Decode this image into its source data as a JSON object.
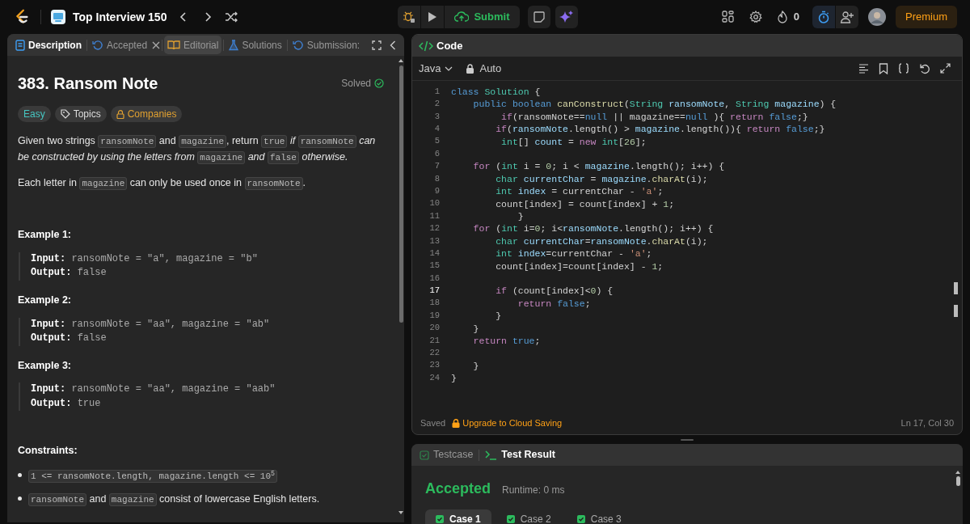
{
  "topbar": {
    "list_title": "Top Interview 150",
    "submit": "Submit",
    "streak": "0",
    "premium": "Premium"
  },
  "description_panel": {
    "tabs": [
      {
        "label": "Description",
        "selected": true,
        "highlighted": false,
        "closable": false
      },
      {
        "label": "Accepted",
        "selected": false,
        "highlighted": false,
        "closable": true
      },
      {
        "label": "Editorial",
        "selected": false,
        "highlighted": true,
        "closable": false
      },
      {
        "label": "Solutions",
        "selected": false,
        "highlighted": false,
        "closable": false
      },
      {
        "label": "Submission:",
        "selected": false,
        "highlighted": false,
        "closable": false
      }
    ],
    "title": "383. Ransom Note",
    "status": "Solved",
    "badges": [
      {
        "label": "Easy",
        "kind": "difficulty"
      },
      {
        "label": "Topics",
        "kind": "topics"
      },
      {
        "label": "Companies",
        "kind": "companies"
      }
    ],
    "paragraphs": [
      [
        {
          "text": "Given two strings ",
          "kind": "text"
        },
        {
          "text": "ransomNote",
          "kind": "code"
        },
        {
          "text": " and ",
          "kind": "text"
        },
        {
          "text": "magazine",
          "kind": "code"
        },
        {
          "text": ", return ",
          "kind": "text"
        },
        {
          "text": "true",
          "kind": "code"
        },
        {
          "text": " if ",
          "kind": "italic"
        },
        {
          "text": "ransomNote",
          "kind": "code"
        },
        {
          "text": " can be constructed by using the letters from ",
          "kind": "italic"
        },
        {
          "text": "magazine",
          "kind": "code"
        },
        {
          "text": " and ",
          "kind": "italic"
        },
        {
          "text": "false",
          "kind": "code"
        },
        {
          "text": " otherwise.",
          "kind": "italic"
        }
      ],
      [
        {
          "text": "Each letter in ",
          "kind": "text"
        },
        {
          "text": "magazine",
          "kind": "code"
        },
        {
          "text": " can only be used once in ",
          "kind": "text"
        },
        {
          "text": "ransomNote",
          "kind": "code"
        },
        {
          "text": ".",
          "kind": "text"
        }
      ]
    ],
    "examples": [
      {
        "heading": "Example 1:",
        "input_label": "Input:",
        "input": "ransomNote = \"a\", magazine = \"b\"",
        "output_label": "Output:",
        "output": "false"
      },
      {
        "heading": "Example 2:",
        "input_label": "Input:",
        "input": "ransomNote = \"aa\", magazine = \"ab\"",
        "output_label": "Output:",
        "output": "false"
      },
      {
        "heading": "Example 3:",
        "input_label": "Input:",
        "input": "ransomNote = \"aa\", magazine = \"aab\"",
        "output_label": "Output:",
        "output": "true"
      }
    ],
    "constraints_heading": "Constraints:",
    "constraints": [
      [
        {
          "text": "1 <= ransomNote.length, magazine.length <= 10$^{5}$",
          "kind": "code"
        }
      ],
      [
        {
          "text": "ransomNote",
          "kind": "code"
        },
        {
          "text": " and ",
          "kind": "text"
        },
        {
          "text": "magazine",
          "kind": "code"
        },
        {
          "text": " consist of lowercase English letters.",
          "kind": "text"
        }
      ]
    ]
  },
  "code_panel": {
    "title": "Code",
    "language": "Java",
    "mode": "Auto",
    "lines": [
      {
        "number": "1",
        "current": false,
        "tokens": [
          {
            "text": "class",
            "kind": "decl"
          },
          {
            "text": " Solution",
            "kind": "type"
          },
          {
            "text": " {",
            "kind": "plain"
          }
        ]
      },
      {
        "number": "2",
        "current": false,
        "tokens": [
          {
            "text": "    public boolean",
            "kind": "decl"
          },
          {
            "text": " canConstruct",
            "kind": "fn"
          },
          {
            "text": "(",
            "kind": "plain"
          },
          {
            "text": "String",
            "kind": "type"
          },
          {
            "text": " ransomNote",
            "kind": "var"
          },
          {
            "text": ", ",
            "kind": "plain"
          },
          {
            "text": "String",
            "kind": "type"
          },
          {
            "text": " magazine",
            "kind": "var"
          },
          {
            "text": ") {",
            "kind": "plain"
          }
        ]
      },
      {
        "number": "3",
        "current": false,
        "tokens": [
          {
            "text": "         if",
            "kind": "kw"
          },
          {
            "text": "(ransomNote==",
            "kind": "plain"
          },
          {
            "text": "null",
            "kind": "decl"
          },
          {
            "text": " || magazine==",
            "kind": "plain"
          },
          {
            "text": "null",
            "kind": "decl"
          },
          {
            "text": " ){ ",
            "kind": "plain"
          },
          {
            "text": "return",
            "kind": "kw"
          },
          {
            "text": " false",
            "kind": "decl"
          },
          {
            "text": ";}",
            "kind": "plain"
          }
        ]
      },
      {
        "number": "4",
        "current": false,
        "tokens": [
          {
            "text": "        if",
            "kind": "kw"
          },
          {
            "text": "(",
            "kind": "plain"
          },
          {
            "text": "ransomNote",
            "kind": "var"
          },
          {
            "text": ".length() > ",
            "kind": "plain"
          },
          {
            "text": "magazine",
            "kind": "var"
          },
          {
            "text": ".length()){ ",
            "kind": "plain"
          },
          {
            "text": "return",
            "kind": "kw"
          },
          {
            "text": " false",
            "kind": "decl"
          },
          {
            "text": ";}",
            "kind": "plain"
          }
        ]
      },
      {
        "number": "5",
        "current": false,
        "tokens": [
          {
            "text": "         int",
            "kind": "type"
          },
          {
            "text": "[] ",
            "kind": "plain"
          },
          {
            "text": "count",
            "kind": "var"
          },
          {
            "text": " = ",
            "kind": "plain"
          },
          {
            "text": "new",
            "kind": "kw"
          },
          {
            "text": " int",
            "kind": "type"
          },
          {
            "text": "[",
            "kind": "plain"
          },
          {
            "text": "26",
            "kind": "num"
          },
          {
            "text": "];",
            "kind": "plain"
          }
        ]
      },
      {
        "number": "6",
        "current": false
      },
      {
        "number": "7",
        "current": false,
        "tokens": [
          {
            "text": "    for",
            "kind": "kw"
          },
          {
            "text": " (",
            "kind": "plain"
          },
          {
            "text": "int",
            "kind": "type"
          },
          {
            "text": " i = ",
            "kind": "plain"
          },
          {
            "text": "0",
            "kind": "num"
          },
          {
            "text": "; i < ",
            "kind": "plain"
          },
          {
            "text": "magazine",
            "kind": "var"
          },
          {
            "text": ".length(); i++) {",
            "kind": "plain"
          }
        ]
      },
      {
        "number": "8",
        "current": false,
        "tokens": [
          {
            "text": "        char",
            "kind": "type"
          },
          {
            "text": " currentChar",
            "kind": "var"
          },
          {
            "text": " = ",
            "kind": "plain"
          },
          {
            "text": "magazine",
            "kind": "var"
          },
          {
            "text": ".",
            "kind": "plain"
          },
          {
            "text": "charAt",
            "kind": "fn"
          },
          {
            "text": "(i);",
            "kind": "plain"
          }
        ]
      },
      {
        "number": "9",
        "current": false,
        "tokens": [
          {
            "text": "        int",
            "kind": "type"
          },
          {
            "text": " index",
            "kind": "var"
          },
          {
            "text": " = currentChar - ",
            "kind": "plain"
          },
          {
            "text": "'a'",
            "kind": "str"
          },
          {
            "text": ";",
            "kind": "plain"
          }
        ]
      },
      {
        "number": "10",
        "current": false,
        "tokens": [
          {
            "text": "        count[index] = count[index] + ",
            "kind": "plain"
          },
          {
            "text": "1",
            "kind": "num"
          },
          {
            "text": ";",
            "kind": "plain"
          }
        ]
      },
      {
        "number": "11",
        "current": false,
        "tokens": [
          {
            "text": "            }",
            "kind": "plain"
          }
        ]
      },
      {
        "number": "12",
        "current": false,
        "tokens": [
          {
            "text": "    for",
            "kind": "kw"
          },
          {
            "text": " (",
            "kind": "plain"
          },
          {
            "text": "int",
            "kind": "type"
          },
          {
            "text": " i=",
            "kind": "plain"
          },
          {
            "text": "0",
            "kind": "num"
          },
          {
            "text": "; i<",
            "kind": "plain"
          },
          {
            "text": "ransomNote",
            "kind": "var"
          },
          {
            "text": ".length(); i++) {",
            "kind": "plain"
          }
        ]
      },
      {
        "number": "13",
        "current": false,
        "tokens": [
          {
            "text": "        char",
            "kind": "type"
          },
          {
            "text": " currentChar",
            "kind": "var"
          },
          {
            "text": "=",
            "kind": "plain"
          },
          {
            "text": "ransomNote",
            "kind": "var"
          },
          {
            "text": ".",
            "kind": "plain"
          },
          {
            "text": "charAt",
            "kind": "fn"
          },
          {
            "text": "(i);",
            "kind": "plain"
          }
        ]
      },
      {
        "number": "14",
        "current": false,
        "tokens": [
          {
            "text": "        int",
            "kind": "type"
          },
          {
            "text": " index",
            "kind": "var"
          },
          {
            "text": "=currentChar - ",
            "kind": "plain"
          },
          {
            "text": "'a'",
            "kind": "str"
          },
          {
            "text": ";",
            "kind": "plain"
          }
        ]
      },
      {
        "number": "15",
        "current": false,
        "tokens": [
          {
            "text": "        count[index]=count[index] - ",
            "kind": "plain"
          },
          {
            "text": "1",
            "kind": "num"
          },
          {
            "text": ";",
            "kind": "plain"
          }
        ]
      },
      {
        "number": "16",
        "current": false
      },
      {
        "number": "17",
        "current": true,
        "tokens": [
          {
            "text": "        if",
            "kind": "kw"
          },
          {
            "text": " (count[index]<",
            "kind": "plain"
          },
          {
            "text": "0",
            "kind": "num"
          },
          {
            "text": ") {",
            "kind": "plain"
          }
        ]
      },
      {
        "number": "18",
        "current": false,
        "tokens": [
          {
            "text": "            return",
            "kind": "kw"
          },
          {
            "text": " false",
            "kind": "decl"
          },
          {
            "text": ";",
            "kind": "plain"
          }
        ]
      },
      {
        "number": "19",
        "current": false,
        "tokens": [
          {
            "text": "        }",
            "kind": "plain"
          }
        ]
      },
      {
        "number": "20",
        "current": false,
        "tokens": [
          {
            "text": "    }",
            "kind": "plain"
          }
        ]
      },
      {
        "number": "21",
        "current": false,
        "tokens": [
          {
            "text": "    return",
            "kind": "kw"
          },
          {
            "text": " true",
            "kind": "decl"
          },
          {
            "text": ";",
            "kind": "plain"
          }
        ]
      },
      {
        "number": "22",
        "current": false
      },
      {
        "number": "23",
        "current": false,
        "tokens": [
          {
            "text": "    }",
            "kind": "plain"
          }
        ]
      },
      {
        "number": "24",
        "current": false,
        "tokens": [
          {
            "text": "}",
            "kind": "plain"
          }
        ]
      }
    ],
    "save_status": "Saved",
    "upgrade_link": "Upgrade to Cloud Saving",
    "cursor_position": "Ln 17, Col 30"
  },
  "result_panel": {
    "tabs": [
      {
        "label": "Testcase",
        "selected": false
      },
      {
        "label": "Test Result",
        "selected": true
      }
    ],
    "verdict": "Accepted",
    "runtime": "Runtime: 0 ms",
    "cases": [
      {
        "label": "Case 1",
        "selected": true
      },
      {
        "label": "Case 2",
        "selected": false
      },
      {
        "label": "Case 3",
        "selected": false
      }
    ]
  }
}
